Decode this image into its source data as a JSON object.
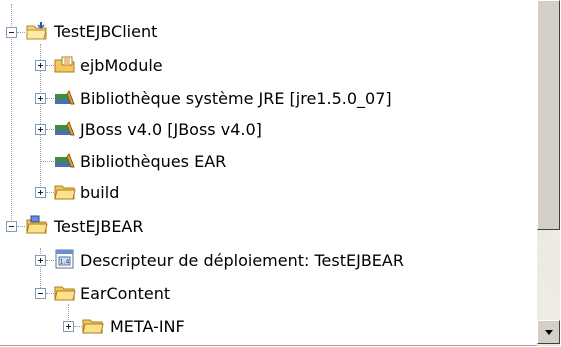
{
  "tree": {
    "items": [
      {
        "label": "TestEJBClient",
        "icon": "project-folder-icon",
        "expanded": true
      },
      {
        "label": "ejbModule",
        "icon": "source-folder-icon",
        "expanded": false
      },
      {
        "label": "Bibliothèque système JRE [jre1.5.0_07]",
        "icon": "library-icon",
        "expanded": false
      },
      {
        "label": "JBoss v4.0 [JBoss v4.0]",
        "icon": "library-icon",
        "expanded": false
      },
      {
        "label": "Bibliothèques EAR",
        "icon": "library-icon",
        "expanded": null
      },
      {
        "label": "build",
        "icon": "folder-icon",
        "expanded": false
      },
      {
        "label": "TestEJBEAR",
        "icon": "ear-project-icon",
        "expanded": true
      },
      {
        "label": "Descripteur de déploiement: TestEJBEAR",
        "icon": "deployment-descriptor-icon",
        "expanded": false
      },
      {
        "label": "EarContent",
        "icon": "folder-open-icon",
        "expanded": true
      },
      {
        "label": "META-INF",
        "icon": "folder-icon",
        "expanded": false
      }
    ]
  },
  "scrollbar": {
    "thumb_fraction": 0.72,
    "position": 0
  }
}
